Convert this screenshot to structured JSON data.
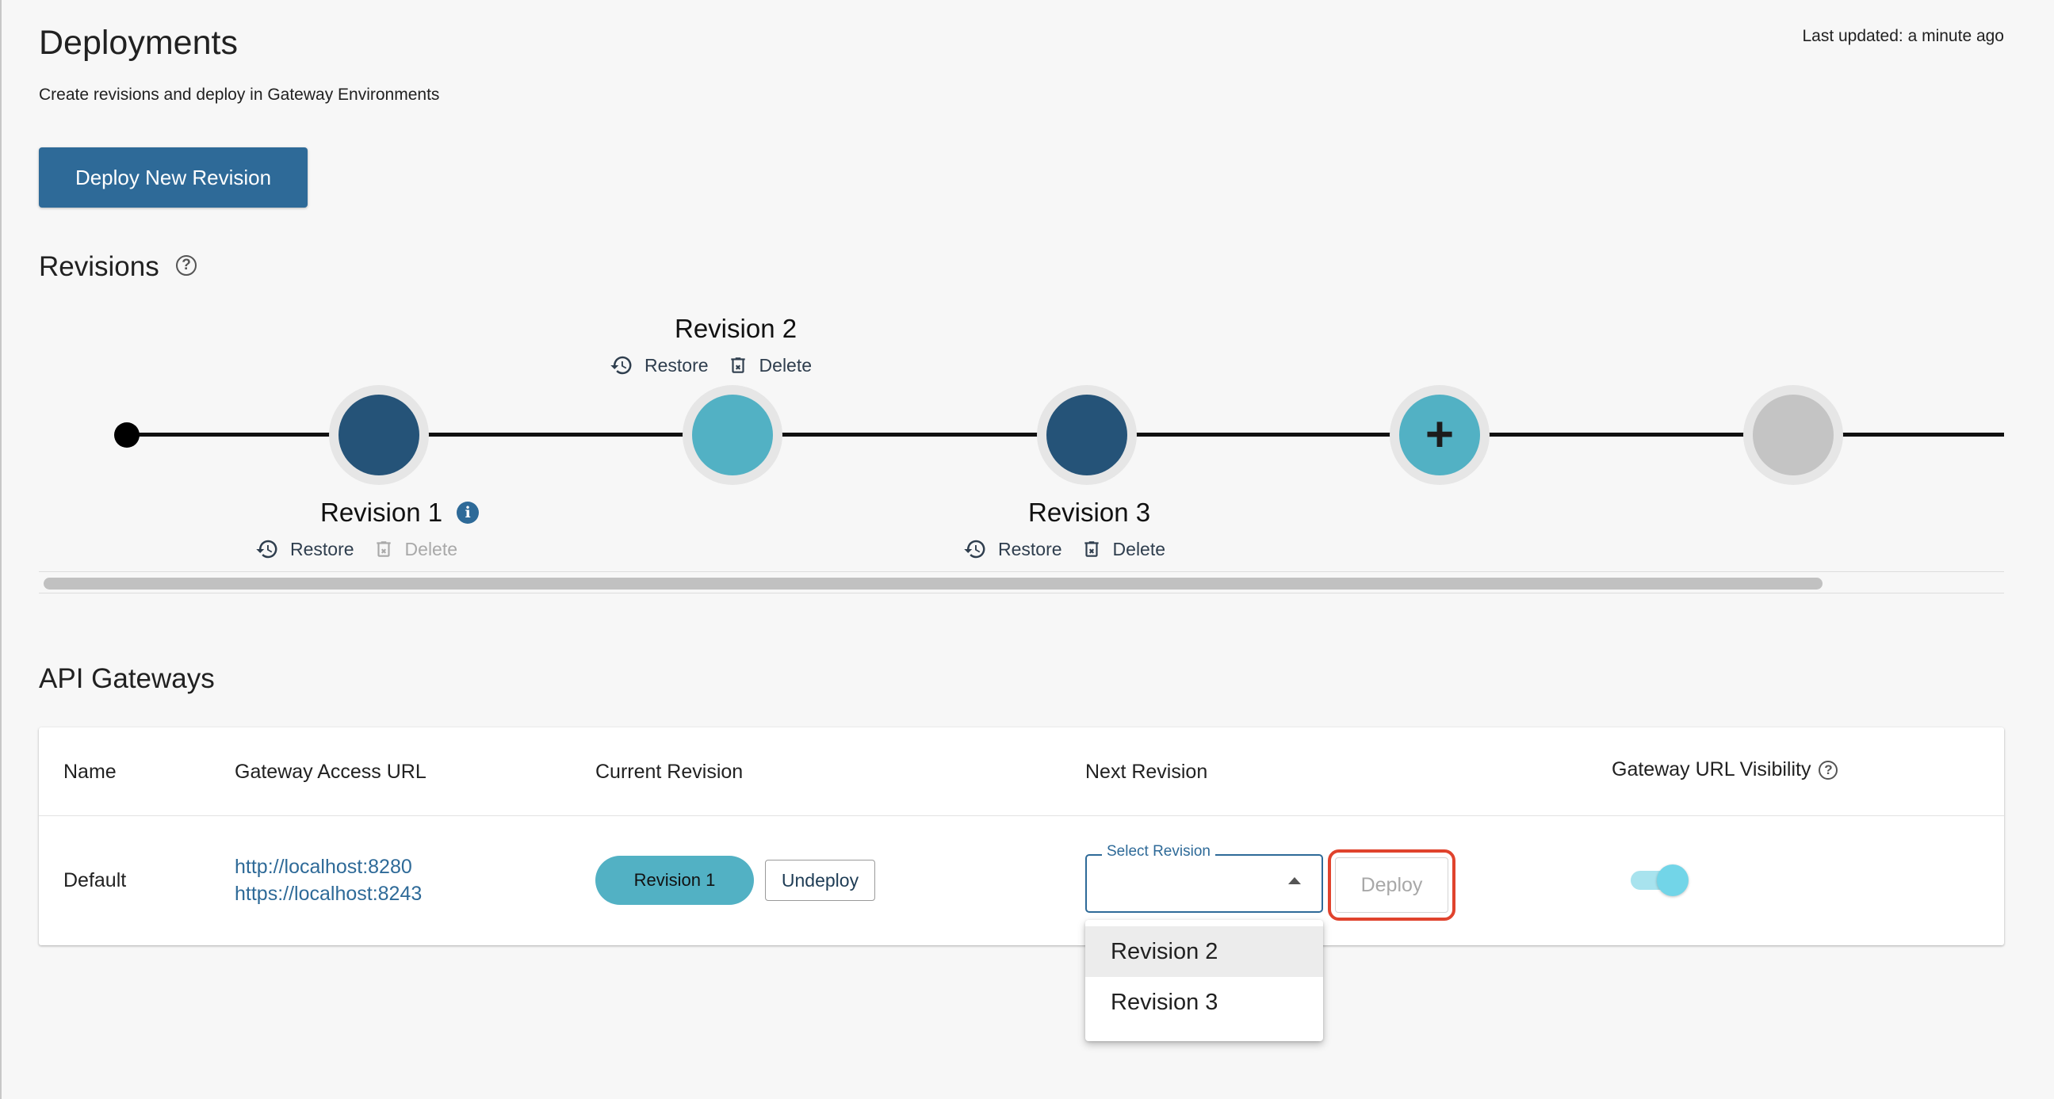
{
  "header": {
    "title": "Deployments",
    "subtitle": "Create revisions and deploy in Gateway Environments",
    "last_updated": "Last updated: a minute ago",
    "deploy_new_label": "Deploy New Revision"
  },
  "revisions": {
    "title": "Revisions",
    "help_icon": "question-circle-icon",
    "items": [
      {
        "label": "Revision 1",
        "restore": "Restore",
        "delete": "Delete",
        "delete_enabled": false,
        "info_icon": "info-icon",
        "node_color": "#255378"
      },
      {
        "label": "Revision 2",
        "restore": "Restore",
        "delete": "Delete",
        "delete_enabled": true,
        "node_color": "#52b1c4"
      },
      {
        "label": "Revision 3",
        "restore": "Restore",
        "delete": "Delete",
        "delete_enabled": true,
        "node_color": "#255378"
      }
    ],
    "add_node_icon": "plus-icon",
    "empty_node_color": "#c4c4c4"
  },
  "gateways": {
    "title": "API Gateways",
    "columns": [
      "Name",
      "Gateway Access URL",
      "Current Revision",
      "Next Revision",
      "Gateway URL Visibility"
    ],
    "rows": [
      {
        "name": "Default",
        "urls": [
          "http://localhost:8280",
          "https://localhost:8243"
        ],
        "current_revision": "Revision 1",
        "undeploy_label": "Undeploy",
        "select_label": "Select Revision",
        "deploy_label": "Deploy",
        "url_visible": true
      }
    ],
    "dropdown_options": [
      "Revision 2",
      "Revision 3"
    ],
    "highlighted_option": "Revision 2"
  },
  "colors": {
    "primary": "#2e6a98",
    "teal": "#52b1c4",
    "dark_node": "#255378",
    "highlight": "#e0432d"
  }
}
